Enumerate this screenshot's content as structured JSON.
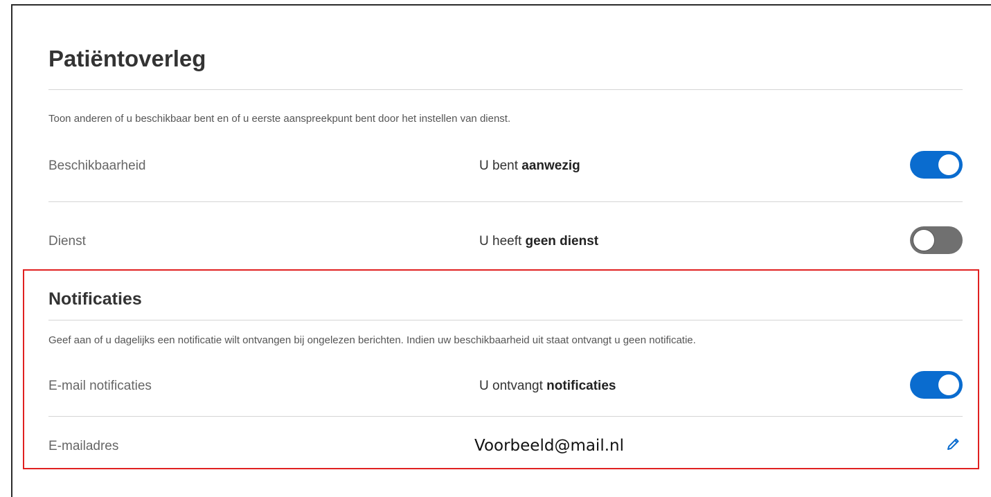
{
  "section": {
    "title": "Patiëntoverleg",
    "description": "Toon anderen of u beschikbaar bent en of u eerste aanspreekpunt bent door het instellen van dienst.",
    "rows": [
      {
        "label": "Beschikbaarheid",
        "status_prefix": "U bent ",
        "status_bold": "aanwezig",
        "toggle_on": true
      },
      {
        "label": "Dienst",
        "status_prefix": "U heeft ",
        "status_bold": "geen dienst",
        "toggle_on": false
      }
    ]
  },
  "notifications": {
    "title": "Notificaties",
    "description": "Geef aan of u dagelijks een notificatie wilt ontvangen bij ongelezen berichten. Indien uw beschikbaarheid uit staat ontvangt u geen notificatie.",
    "email_notifications": {
      "label": "E-mail notificaties",
      "status_prefix": "U ontvangt ",
      "status_bold": "notificaties",
      "toggle_on": true
    },
    "email_address": {
      "label": "E-mailadres",
      "value": "Voorbeeld@mail.nl",
      "edit_icon": "pencil-icon"
    }
  },
  "colors": {
    "toggle_on": "#0a6ccf",
    "toggle_off": "#707070",
    "highlight": "#e02020"
  }
}
